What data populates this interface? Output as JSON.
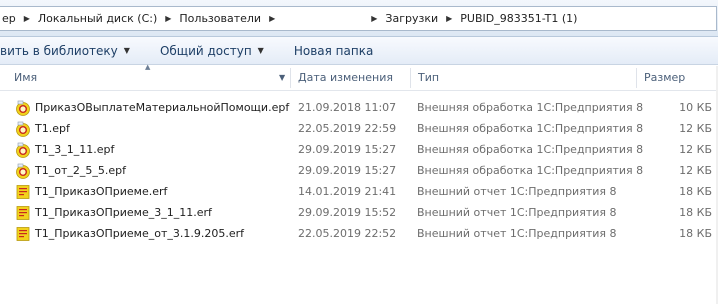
{
  "breadcrumb": {
    "items": [
      "ер",
      "Локальный диск (C:)",
      "Пользователи",
      "Загрузки",
      "PUBID_983351-T1 (1)"
    ]
  },
  "toolbar": {
    "add_to_library": "вить в библиотеку",
    "share": "Общий доступ",
    "new_folder": "Новая папка"
  },
  "columns": {
    "name": "Имя",
    "date": "Дата изменения",
    "type": "Тип",
    "size": "Размер"
  },
  "files": [
    {
      "name": "ПриказОВыплатеМатериальнойПомощи.epf",
      "date": "21.09.2018 11:07",
      "type": "Внешняя обработка 1С:Предприятия 8",
      "size": "10 КБ",
      "icon": "epf-file-icon"
    },
    {
      "name": "T1.epf",
      "date": "22.05.2019 22:59",
      "type": "Внешняя обработка 1С:Предприятия 8",
      "size": "12 КБ",
      "icon": "epf-file-icon"
    },
    {
      "name": "T1_3_1_11.epf",
      "date": "29.09.2019 15:27",
      "type": "Внешняя обработка 1С:Предприятия 8",
      "size": "12 КБ",
      "icon": "epf-file-icon"
    },
    {
      "name": "T1_от_2_5_5.epf",
      "date": "29.09.2019 15:27",
      "type": "Внешняя обработка 1С:Предприятия 8",
      "size": "12 КБ",
      "icon": "epf-file-icon"
    },
    {
      "name": "T1_ПриказОПриеме.erf",
      "date": "14.01.2019 21:41",
      "type": "Внешний отчет 1С:Предприятия 8",
      "size": "18 КБ",
      "icon": "erf-file-icon"
    },
    {
      "name": "T1_ПриказОПриеме_3_1_11.erf",
      "date": "29.09.2019 15:52",
      "type": "Внешний отчет 1С:Предприятия 8",
      "size": "18 КБ",
      "icon": "erf-file-icon"
    },
    {
      "name": "T1_ПриказОПриеме_от_3.1.9.205.erf",
      "date": "22.05.2019 22:52",
      "type": "Внешний отчет 1С:Предприятия 8",
      "size": "18 КБ",
      "icon": "erf-file-icon"
    }
  ],
  "colors": {
    "toolbar_text": "#1e3f66",
    "header_text": "#4c607a",
    "secondary_text": "#6d6d6d",
    "icon_yellow": "#f2d21c",
    "icon_red": "#d8281e"
  }
}
